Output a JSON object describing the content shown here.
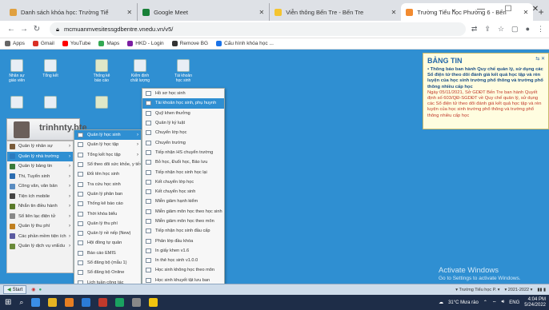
{
  "browser": {
    "tabs": [
      {
        "title": "Danh sách khóa học: Trường Tiể",
        "color": "#e0a040"
      },
      {
        "title": "Google Meet",
        "color": "#188038"
      },
      {
        "title": "Viễn thông Bến Tre - Bến Tre",
        "color": "#f4c430"
      },
      {
        "title": "Trường Tiểu học Phường 6 - Bến",
        "color": "#f28b30"
      }
    ],
    "url": "mcmuanmvesitessgdbentre.vnedu.vn/v5/",
    "bookmarks": [
      {
        "label": "Apps",
        "color": "#666"
      },
      {
        "label": "Gmail",
        "color": "#d93025"
      },
      {
        "label": "YouTube",
        "color": "#ff0000"
      },
      {
        "label": "Maps",
        "color": "#34a853"
      },
      {
        "label": "HKD - Login",
        "color": "#7b1fa2"
      },
      {
        "label": "Remove BG",
        "color": "#333"
      },
      {
        "label": "Cấu hình khóa học ...",
        "color": "#1a73e8"
      }
    ]
  },
  "desktop": {
    "icons": [
      "Nhân sự giáo viên",
      "Tổng kết",
      "Thống kê báo cáo",
      "Kiểm định chất lượng",
      "Tài khoản học sinh"
    ],
    "username": "trinhnty.bte"
  },
  "left_menu": [
    {
      "label": "Quản lý nhân sự",
      "color": "#7a5c3a"
    },
    {
      "label": "Quản lý nhà trường",
      "color": "#2b7bbf",
      "selected": true
    },
    {
      "label": "Quản lý bảng tin",
      "color": "#3a7a3a"
    },
    {
      "label": "Thi, Tuyển sinh",
      "color": "#2b6cb0"
    },
    {
      "label": "Công văn, văn bản",
      "color": "#5a8cc0"
    },
    {
      "label": "Tiện ích mobile",
      "color": "#444"
    },
    {
      "label": "Nhắn tin điều hành",
      "color": "#5a7a2a"
    },
    {
      "label": "Sổ liên lạc điện tử",
      "color": "#888"
    },
    {
      "label": "Quản lý thu phí",
      "color": "#c08020"
    },
    {
      "label": "Các phần mềm tiện ích",
      "color": "#5a5aa0"
    },
    {
      "label": "Quản lý dịch vụ vnEdu",
      "color": "#6a8a3a"
    }
  ],
  "submenu1": [
    "Quản lý học sinh",
    "Quản lý học tập",
    "Tổng kết học tập",
    "Sổ theo dõi sức khỏe, y tế",
    "Đối tên học sinh",
    "Tra cứu học sinh",
    "Quản lý phân ban",
    "Thống kê báo cáo",
    "Thời khóa biểu",
    "Quản lý thu phí",
    "Quản lý nề nếp (New)",
    "Hội đồng tự quản",
    "Báo cáo EMIS",
    "Sổ đăng bộ (mẫu 1)",
    "Sổ đăng bộ Online",
    "Lịch tuần công tác"
  ],
  "submenu2": [
    "Hồ sơ học sinh",
    "Tài khoản học sinh, phụ huynh",
    "Quỹ khen thưởng",
    "Quản lý kỷ luật",
    "Chuyển lớp học",
    "Chuyển trường",
    "Tiếp nhận HS chuyển trường",
    "Bỏ học, Đuổi học, Bảo lưu",
    "Tiếp nhận học sinh học lại",
    "Kết chuyển lớp học",
    "Kết chuyển học sinh",
    "Miễn giảm hạnh kiểm",
    "Miễn giảm môn học theo học sinh",
    "Miễn giảm môn học theo môn",
    "Tiếp nhận học sinh đầu cấp",
    "Phân lớp đầu khóa",
    "In giấy khen v1.6",
    "In thẻ học sinh v1.0.0",
    "Học sinh không học theo môn",
    "Học sinh khuyết tật lưu ban"
  ],
  "bangtin": {
    "title": "BẢNG TIN",
    "news1": "Thông báo ban hành Quy chế quản lý, sử dụng các Sổ điện tử theo dõi đánh giá kết quả học tập và rèn luyện của học sinh trường phổ thông và trường phổ thông nhiều cấp học",
    "news2": "Ngày 05/11/2021, Sở GDĐT Bến Tre ban hành Quyết định số 603/QĐ-SGDĐT về Quy chế quản lý, sử dụng các Sổ điện tử theo dõi đánh giá kết quả học tập và rèn luyện của học sinh trường phổ thông và trường phổ thông nhiều cấp học"
  },
  "watermark": {
    "title": "Activate Windows",
    "sub": "Go to Settings to activate Windows."
  },
  "appbar": {
    "start": "Start",
    "school": "Trường Tiểu học P.",
    "year": "2021-2022"
  },
  "taskbar": {
    "weather": "31°C Mưa rào",
    "lang": "ENG",
    "time": "4:04 PM",
    "date": "5/24/2022"
  }
}
